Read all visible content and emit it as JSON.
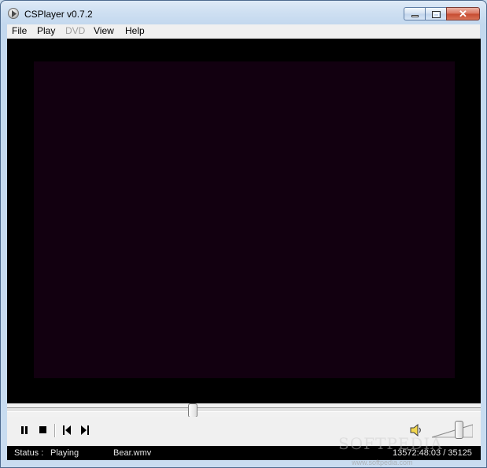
{
  "window": {
    "title": "CSPlayer v0.7.2",
    "close_glyph": "✕"
  },
  "menu": {
    "items": [
      {
        "label": "File",
        "enabled": true
      },
      {
        "label": "Play",
        "enabled": true
      },
      {
        "label": "DVD",
        "enabled": false
      },
      {
        "label": "View",
        "enabled": true
      },
      {
        "label": "Help",
        "enabled": true
      }
    ]
  },
  "playback": {
    "seek_position": 0.39,
    "volume": 0.7
  },
  "icons": {
    "app": "play-circle-icon",
    "pause": "pause-icon",
    "stop": "stop-icon",
    "prev_frame": "step-backward-icon",
    "next_frame": "step-forward-icon",
    "volume": "speaker-icon"
  },
  "status": {
    "label": "Status :",
    "value": "Playing",
    "filename": "Bear.wmv",
    "time": "13572:48:03 / 35125"
  },
  "watermark": {
    "brand": "SOFTPEDIA",
    "url": "www.softpedia.com"
  },
  "colors": {
    "video_frame": "#120010",
    "video_background": "#000000",
    "status_background": "#000000"
  }
}
